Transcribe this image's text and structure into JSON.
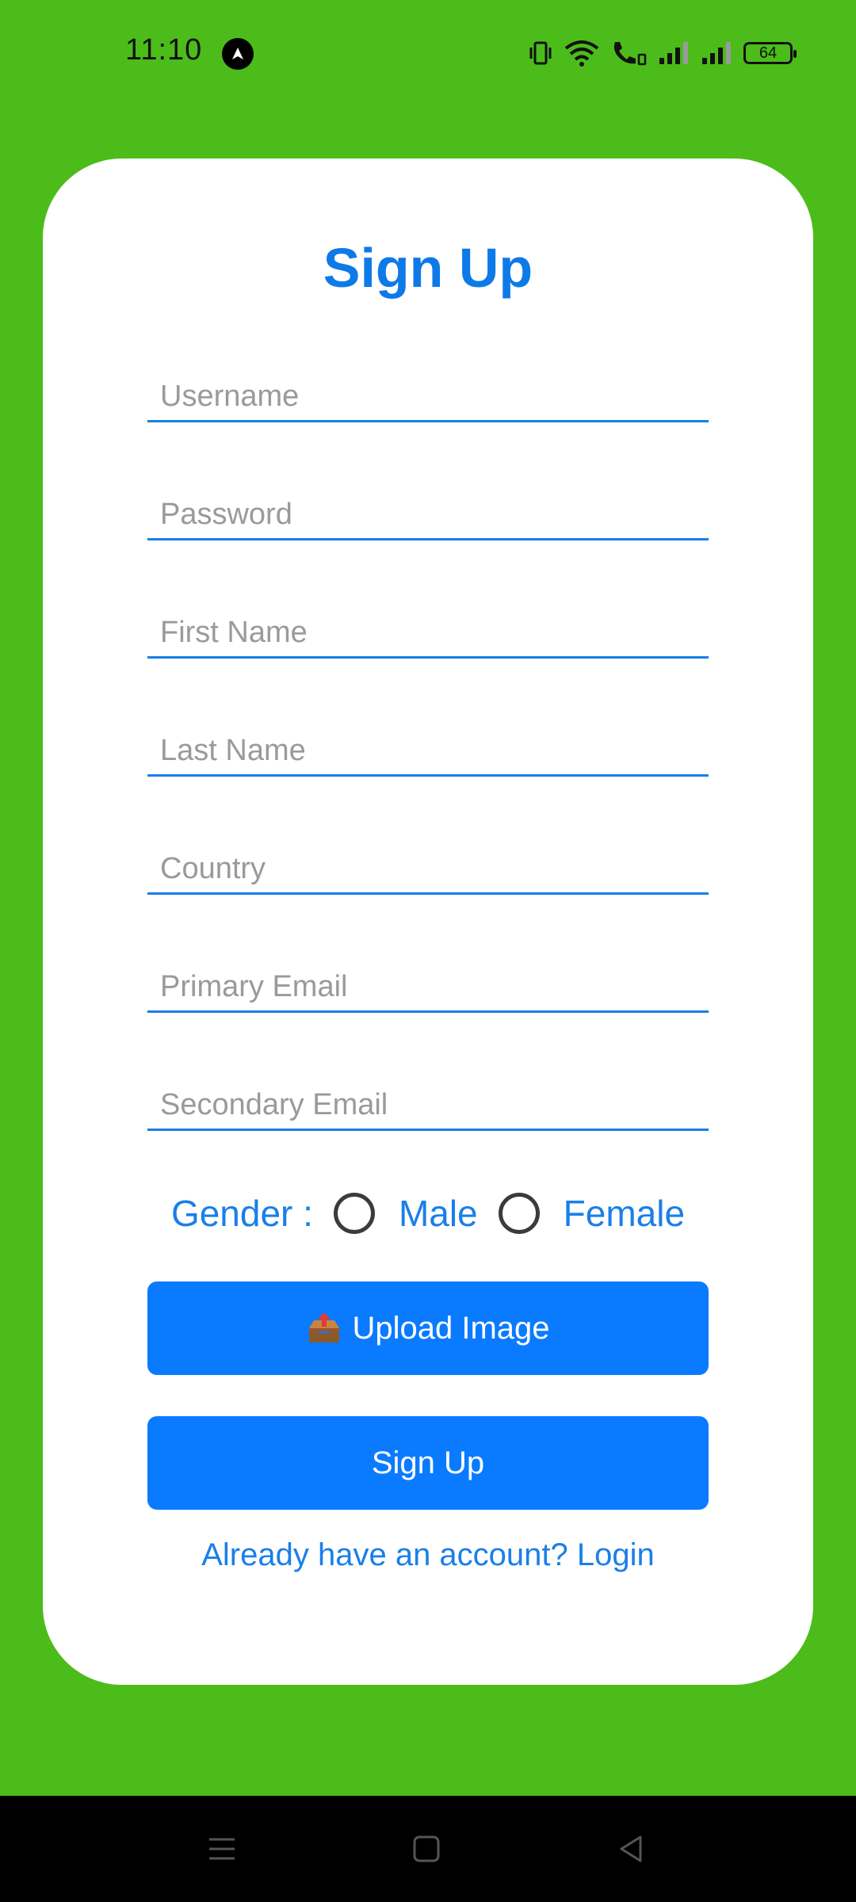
{
  "status_bar": {
    "time": "11:10",
    "app_icon": "navigation-arrow-icon",
    "battery_level": "64",
    "icons": [
      "vibrate-icon",
      "wifi-icon",
      "wifi-calling-icon",
      "signal-icon",
      "signal-icon",
      "battery-icon"
    ]
  },
  "form": {
    "title": "Sign Up",
    "fields": [
      {
        "placeholder": "Username",
        "value": ""
      },
      {
        "placeholder": "Password",
        "value": ""
      },
      {
        "placeholder": "First Name",
        "value": ""
      },
      {
        "placeholder": "Last Name",
        "value": ""
      },
      {
        "placeholder": "Country",
        "value": ""
      },
      {
        "placeholder": "Primary Email",
        "value": ""
      },
      {
        "placeholder": "Secondary Email",
        "value": ""
      }
    ],
    "gender": {
      "label": "Gender :",
      "options": [
        "Male",
        "Female"
      ]
    },
    "upload_label": "Upload Image",
    "upload_icon": "outbox-tray-icon",
    "signup_label": "Sign Up",
    "login_link": "Already have an account? Login"
  },
  "nav_bar": {
    "buttons": [
      "menu-icon",
      "home-icon",
      "back-icon"
    ]
  },
  "colors": {
    "background": "#4cbc1a",
    "accent": "#0a7bff",
    "text_accent": "#1a7fe8"
  }
}
